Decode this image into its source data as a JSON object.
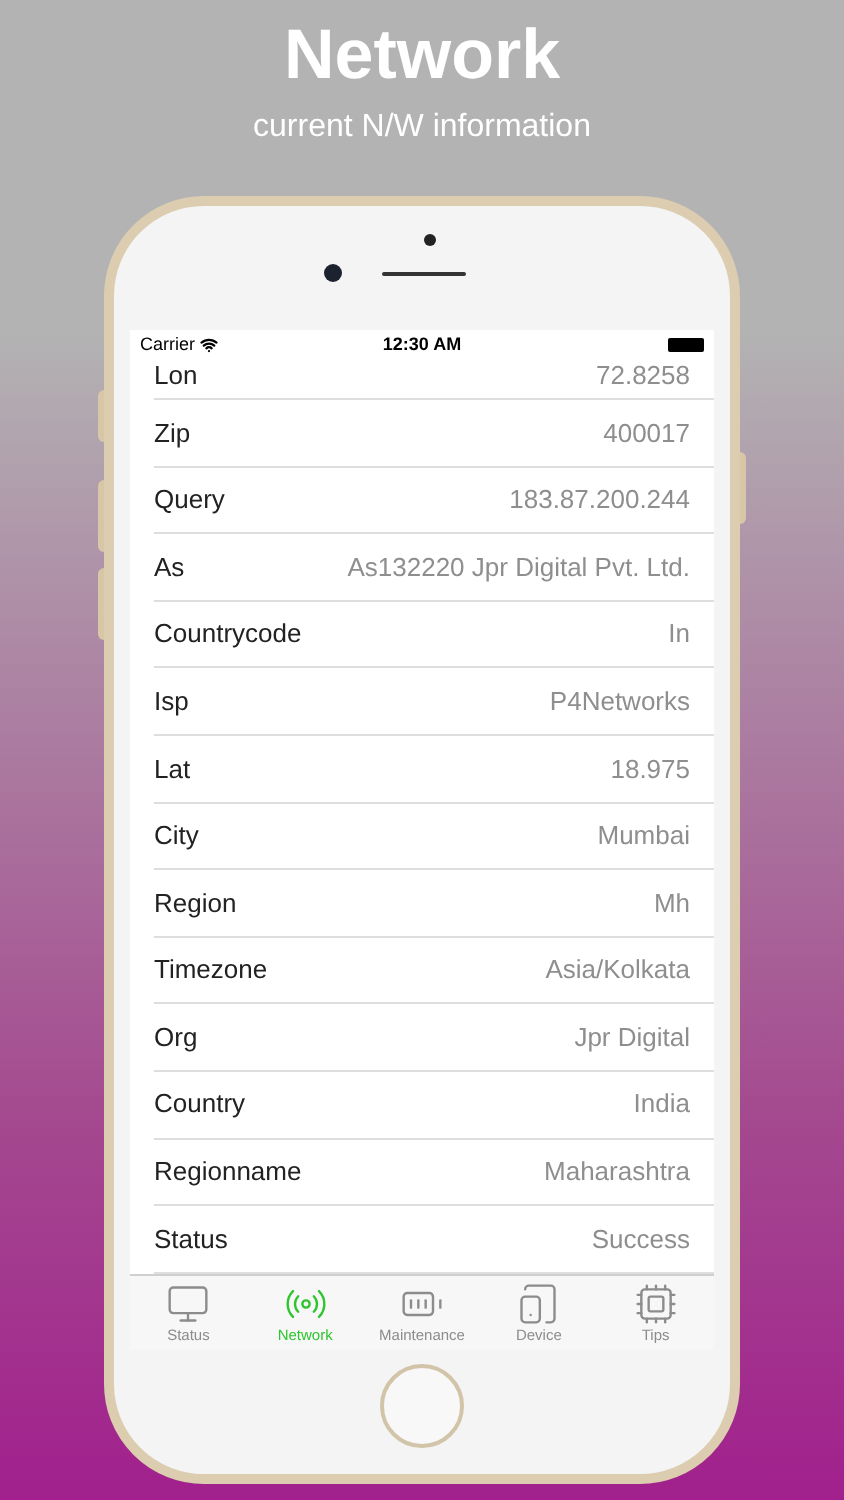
{
  "header": {
    "title": "Network",
    "subtitle": "current N/W information"
  },
  "status_bar": {
    "carrier": "Carrier",
    "time": "12:30 AM"
  },
  "rows": [
    {
      "label": "Lon",
      "value": "72.8258"
    },
    {
      "label": "Zip",
      "value": "400017"
    },
    {
      "label": "Query",
      "value": "183.87.200.244"
    },
    {
      "label": "As",
      "value": "As132220 Jpr Digital Pvt. Ltd."
    },
    {
      "label": "Countrycode",
      "value": "In"
    },
    {
      "label": "Isp",
      "value": "P4Networks"
    },
    {
      "label": "Lat",
      "value": "18.975"
    },
    {
      "label": "City",
      "value": "Mumbai"
    },
    {
      "label": "Region",
      "value": "Mh"
    },
    {
      "label": "Timezone",
      "value": "Asia/Kolkata"
    },
    {
      "label": "Org",
      "value": "Jpr Digital"
    },
    {
      "label": "Country",
      "value": "India"
    },
    {
      "label": "Regionname",
      "value": "Maharashtra"
    },
    {
      "label": "Status",
      "value": "Success"
    }
  ],
  "tabs": [
    {
      "label": "Status",
      "kind": "monitor",
      "selected": false
    },
    {
      "label": "Network",
      "kind": "antenna",
      "selected": true
    },
    {
      "label": "Maintenance",
      "kind": "battery",
      "selected": false
    },
    {
      "label": "Device",
      "kind": "devices",
      "selected": false
    },
    {
      "label": "Tips",
      "kind": "chip",
      "selected": false
    }
  ]
}
